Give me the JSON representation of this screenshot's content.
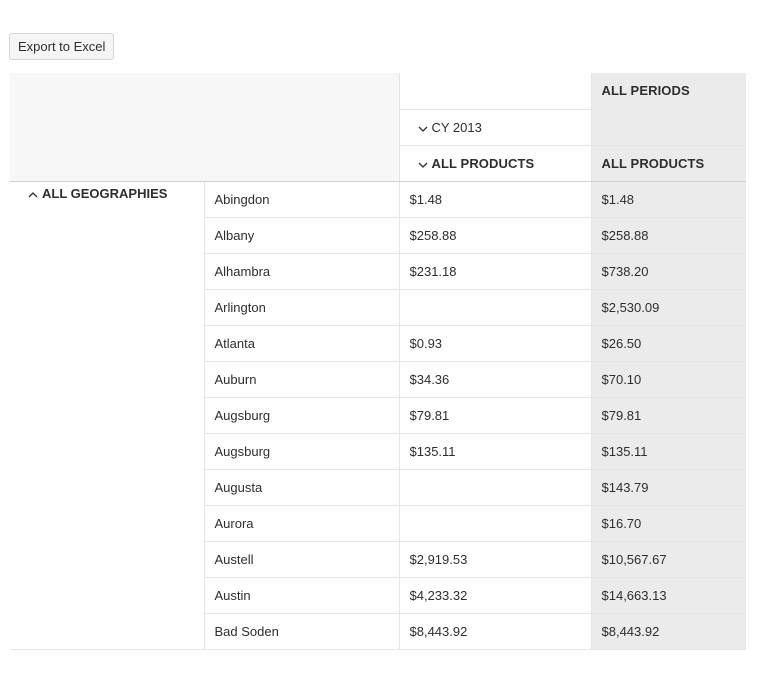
{
  "toolbar": {
    "export_label": "Export to Excel"
  },
  "headers": {
    "all_periods": "ALL PERIODS",
    "cy": "CY 2013",
    "all_products_cy": "ALL PRODUCTS",
    "all_products_total": "ALL PRODUCTS",
    "all_geographies": "ALL GEOGRAPHIES"
  },
  "rows": [
    {
      "city": "Abingdon",
      "cy": "$1.48",
      "total": "$1.48"
    },
    {
      "city": "Albany",
      "cy": "$258.88",
      "total": "$258.88"
    },
    {
      "city": "Alhambra",
      "cy": "$231.18",
      "total": "$738.20"
    },
    {
      "city": "Arlington",
      "cy": "",
      "total": "$2,530.09"
    },
    {
      "city": "Atlanta",
      "cy": "$0.93",
      "total": "$26.50"
    },
    {
      "city": "Auburn",
      "cy": "$34.36",
      "total": "$70.10"
    },
    {
      "city": "Augsburg",
      "cy": "$79.81",
      "total": "$79.81"
    },
    {
      "city": "Augsburg",
      "cy": "$135.11",
      "total": "$135.11"
    },
    {
      "city": "Augusta",
      "cy": "",
      "total": "$143.79"
    },
    {
      "city": "Aurora",
      "cy": "",
      "total": "$16.70"
    },
    {
      "city": "Austell",
      "cy": "$2,919.53",
      "total": "$10,567.67"
    },
    {
      "city": "Austin",
      "cy": "$4,233.32",
      "total": "$14,663.13"
    },
    {
      "city": "Bad Soden",
      "cy": "$8,443.92",
      "total": "$8,443.92"
    }
  ]
}
